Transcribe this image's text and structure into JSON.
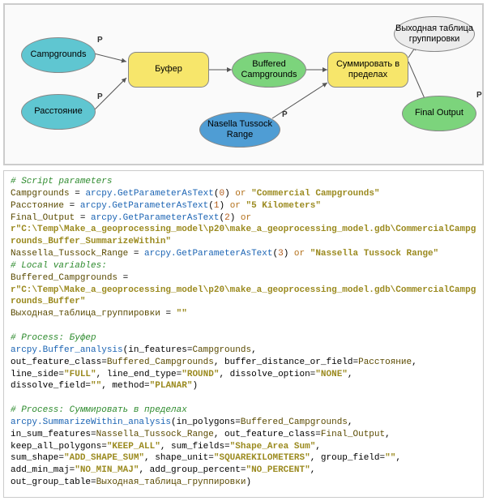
{
  "diagram": {
    "nodes": {
      "campgrounds": "Campgrounds",
      "distance": "Расстояние",
      "buffer": "Буфер",
      "buffered": "Buffered Campgrounds",
      "nasella": "Nasella Tussock Range",
      "summarize": "Суммировать в пределах",
      "outtable": "Выходная таблица группировки",
      "final": "Final Output"
    },
    "badge": "P"
  },
  "code": {
    "c1": "# Script parameters",
    "l1a": "Campgrounds",
    "l1b": " = ",
    "l1c": "arcpy.GetParameterAsText",
    "l1d": "(",
    "l1e": "0",
    "l1f": ") ",
    "l1g": "or",
    "l1h": " ",
    "l1i": "\"Commercial Campgrounds\"",
    "l2a": "Расстояние",
    "l2c": "arcpy.GetParameterAsText",
    "l2e": "1",
    "l2i": "\"5 Kilometers\"",
    "l3a": "Final_Output",
    "l3c": "arcpy.GetParameterAsText",
    "l3e": "2",
    "l3i": "r\"C:\\Temp\\Make_a_geoprocessing_model\\p20\\make_a_geoprocessing_model.gdb\\CommercialCampgrounds_Buffer_SummarizeWithin\"",
    "l4a": "Nassella_Tussock_Range",
    "l4c": "arcpy.GetParameterAsText",
    "l4e": "3",
    "l4i": "\"Nassella Tussock Range\"",
    "c2": "# Local variables:",
    "l5a": "Buffered_Campgrounds",
    "l5b": " = ",
    "l5c": "r\"C:\\Temp\\Make_a_geoprocessing_model\\p20\\make_a_geoprocessing_model.gdb\\CommercialCampgrounds_Buffer\"",
    "l6a": "Выходная_таблица_группировки",
    "l6b": " = ",
    "l6c": "\"\"",
    "c3": "# Process: Буфер",
    "l7a": "arcpy.Buffer_analysis",
    "l7b": "(in_features=",
    "l7c": "Campgrounds",
    "l7d": ",",
    "l8a": "out_feature_class=",
    "l8b": "Buffered_Campgrounds",
    "l8c": ", buffer_distance_or_field=",
    "l8d": "Расстояние",
    "l8e": ",",
    "l9a": "line_side=",
    "l9b": "\"FULL\"",
    "l9c": ", line_end_type=",
    "l9d": "\"ROUND\"",
    "l9e": ", dissolve_option=",
    "l9f": "\"NONE\"",
    "l9g": ",",
    "l10a": "dissolve_field=",
    "l10b": "\"\"",
    "l10c": ", method=",
    "l10d": "\"PLANAR\"",
    "l10e": ")",
    "c4": "# Process: Суммировать в пределах",
    "l11a": "arcpy.SummarizeWithin_analysis",
    "l11b": "(in_polygons=",
    "l11c": "Buffered_Campgrounds",
    "l11d": ",",
    "l12a": "in_sum_features=",
    "l12b": "Nassella_Tussock_Range",
    "l12c": ", out_feature_class=",
    "l12d": "Final_Output",
    "l12e": ",",
    "l13a": "keep_all_polygons=",
    "l13b": "\"KEEP_ALL\"",
    "l13c": ", sum_fields=",
    "l13d": "\"Shape_Area Sum\"",
    "l13e": ",",
    "l14a": "sum_shape=",
    "l14b": "\"ADD_SHAPE_SUM\"",
    "l14c": ", shape_unit=",
    "l14d": "\"SQUAREKILOMETERS\"",
    "l14e": ", group_field=",
    "l14f": "\"\"",
    "l14g": ",",
    "l15a": "add_min_maj=",
    "l15b": "\"NO_MIN_MAJ\"",
    "l15c": ", add_group_percent=",
    "l15d": "\"NO_PERCENT\"",
    "l15e": ",",
    "l16a": "out_group_table=",
    "l16b": "Выходная_таблица_группировки",
    "l16c": ")"
  }
}
